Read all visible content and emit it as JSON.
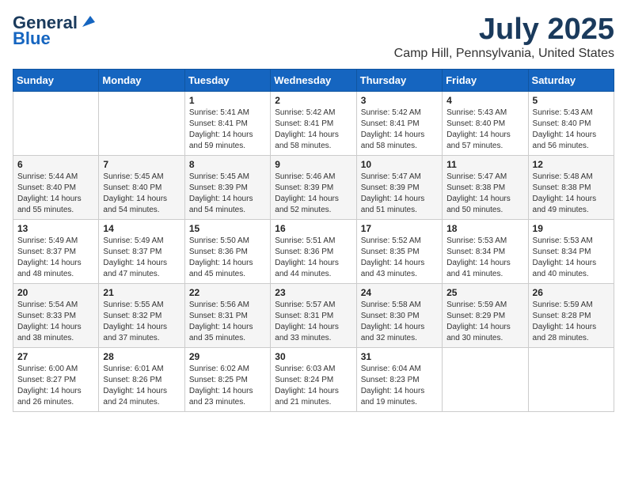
{
  "logo": {
    "line1": "General",
    "line2": "Blue"
  },
  "title": {
    "month_year": "July 2025",
    "location": "Camp Hill, Pennsylvania, United States"
  },
  "weekdays": [
    "Sunday",
    "Monday",
    "Tuesday",
    "Wednesday",
    "Thursday",
    "Friday",
    "Saturday"
  ],
  "weeks": [
    [
      {
        "day": "",
        "info": ""
      },
      {
        "day": "",
        "info": ""
      },
      {
        "day": "1",
        "info": "Sunrise: 5:41 AM\nSunset: 8:41 PM\nDaylight: 14 hours\nand 59 minutes."
      },
      {
        "day": "2",
        "info": "Sunrise: 5:42 AM\nSunset: 8:41 PM\nDaylight: 14 hours\nand 58 minutes."
      },
      {
        "day": "3",
        "info": "Sunrise: 5:42 AM\nSunset: 8:41 PM\nDaylight: 14 hours\nand 58 minutes."
      },
      {
        "day": "4",
        "info": "Sunrise: 5:43 AM\nSunset: 8:40 PM\nDaylight: 14 hours\nand 57 minutes."
      },
      {
        "day": "5",
        "info": "Sunrise: 5:43 AM\nSunset: 8:40 PM\nDaylight: 14 hours\nand 56 minutes."
      }
    ],
    [
      {
        "day": "6",
        "info": "Sunrise: 5:44 AM\nSunset: 8:40 PM\nDaylight: 14 hours\nand 55 minutes."
      },
      {
        "day": "7",
        "info": "Sunrise: 5:45 AM\nSunset: 8:40 PM\nDaylight: 14 hours\nand 54 minutes."
      },
      {
        "day": "8",
        "info": "Sunrise: 5:45 AM\nSunset: 8:39 PM\nDaylight: 14 hours\nand 54 minutes."
      },
      {
        "day": "9",
        "info": "Sunrise: 5:46 AM\nSunset: 8:39 PM\nDaylight: 14 hours\nand 52 minutes."
      },
      {
        "day": "10",
        "info": "Sunrise: 5:47 AM\nSunset: 8:39 PM\nDaylight: 14 hours\nand 51 minutes."
      },
      {
        "day": "11",
        "info": "Sunrise: 5:47 AM\nSunset: 8:38 PM\nDaylight: 14 hours\nand 50 minutes."
      },
      {
        "day": "12",
        "info": "Sunrise: 5:48 AM\nSunset: 8:38 PM\nDaylight: 14 hours\nand 49 minutes."
      }
    ],
    [
      {
        "day": "13",
        "info": "Sunrise: 5:49 AM\nSunset: 8:37 PM\nDaylight: 14 hours\nand 48 minutes."
      },
      {
        "day": "14",
        "info": "Sunrise: 5:49 AM\nSunset: 8:37 PM\nDaylight: 14 hours\nand 47 minutes."
      },
      {
        "day": "15",
        "info": "Sunrise: 5:50 AM\nSunset: 8:36 PM\nDaylight: 14 hours\nand 45 minutes."
      },
      {
        "day": "16",
        "info": "Sunrise: 5:51 AM\nSunset: 8:36 PM\nDaylight: 14 hours\nand 44 minutes."
      },
      {
        "day": "17",
        "info": "Sunrise: 5:52 AM\nSunset: 8:35 PM\nDaylight: 14 hours\nand 43 minutes."
      },
      {
        "day": "18",
        "info": "Sunrise: 5:53 AM\nSunset: 8:34 PM\nDaylight: 14 hours\nand 41 minutes."
      },
      {
        "day": "19",
        "info": "Sunrise: 5:53 AM\nSunset: 8:34 PM\nDaylight: 14 hours\nand 40 minutes."
      }
    ],
    [
      {
        "day": "20",
        "info": "Sunrise: 5:54 AM\nSunset: 8:33 PM\nDaylight: 14 hours\nand 38 minutes."
      },
      {
        "day": "21",
        "info": "Sunrise: 5:55 AM\nSunset: 8:32 PM\nDaylight: 14 hours\nand 37 minutes."
      },
      {
        "day": "22",
        "info": "Sunrise: 5:56 AM\nSunset: 8:31 PM\nDaylight: 14 hours\nand 35 minutes."
      },
      {
        "day": "23",
        "info": "Sunrise: 5:57 AM\nSunset: 8:31 PM\nDaylight: 14 hours\nand 33 minutes."
      },
      {
        "day": "24",
        "info": "Sunrise: 5:58 AM\nSunset: 8:30 PM\nDaylight: 14 hours\nand 32 minutes."
      },
      {
        "day": "25",
        "info": "Sunrise: 5:59 AM\nSunset: 8:29 PM\nDaylight: 14 hours\nand 30 minutes."
      },
      {
        "day": "26",
        "info": "Sunrise: 5:59 AM\nSunset: 8:28 PM\nDaylight: 14 hours\nand 28 minutes."
      }
    ],
    [
      {
        "day": "27",
        "info": "Sunrise: 6:00 AM\nSunset: 8:27 PM\nDaylight: 14 hours\nand 26 minutes."
      },
      {
        "day": "28",
        "info": "Sunrise: 6:01 AM\nSunset: 8:26 PM\nDaylight: 14 hours\nand 24 minutes."
      },
      {
        "day": "29",
        "info": "Sunrise: 6:02 AM\nSunset: 8:25 PM\nDaylight: 14 hours\nand 23 minutes."
      },
      {
        "day": "30",
        "info": "Sunrise: 6:03 AM\nSunset: 8:24 PM\nDaylight: 14 hours\nand 21 minutes."
      },
      {
        "day": "31",
        "info": "Sunrise: 6:04 AM\nSunset: 8:23 PM\nDaylight: 14 hours\nand 19 minutes."
      },
      {
        "day": "",
        "info": ""
      },
      {
        "day": "",
        "info": ""
      }
    ]
  ]
}
